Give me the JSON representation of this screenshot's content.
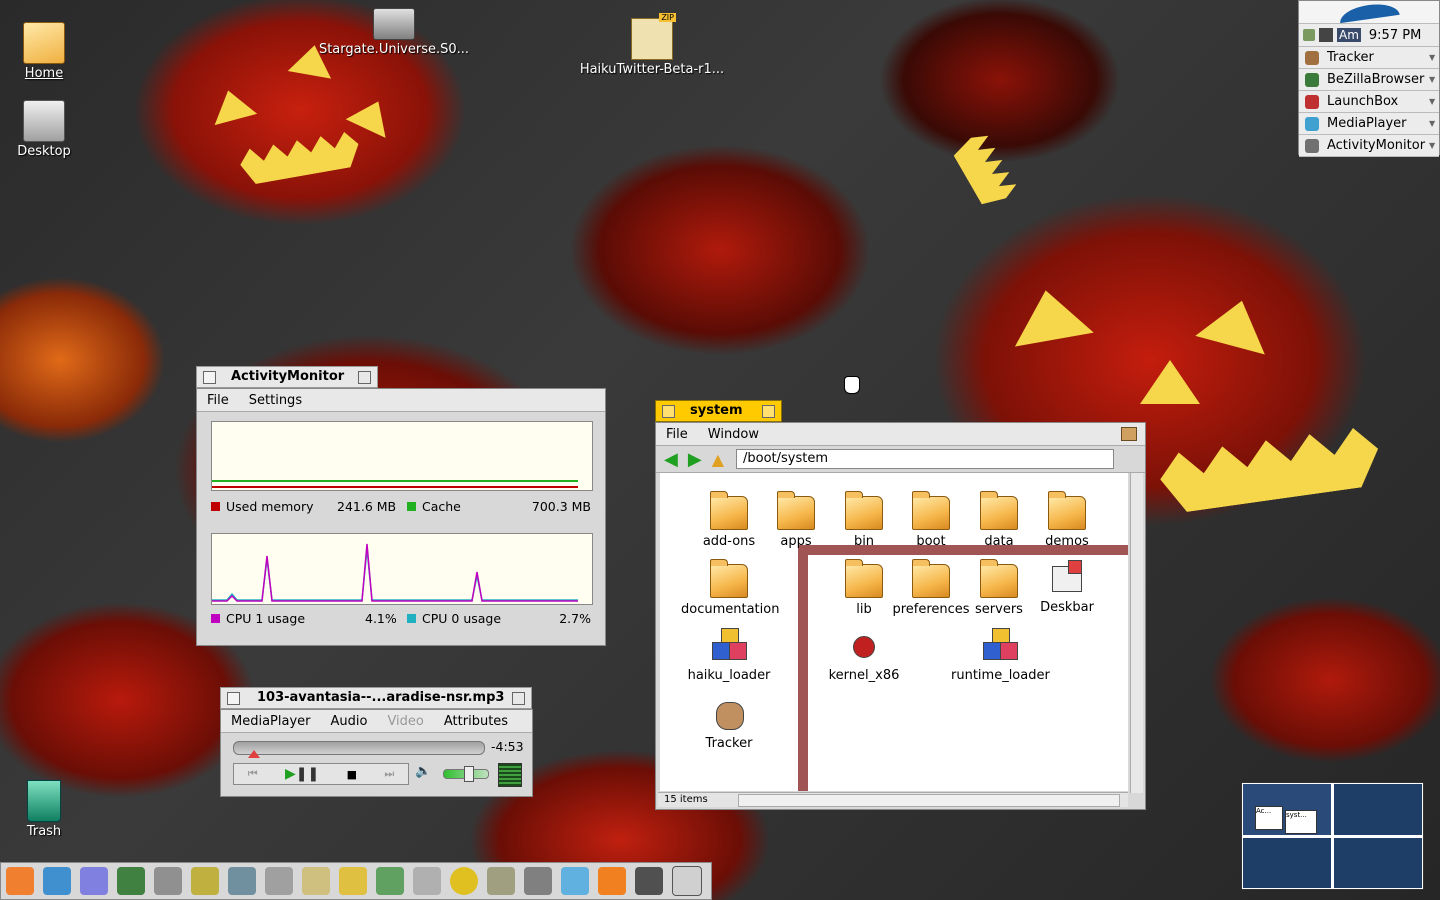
{
  "desktop": {
    "icons": [
      {
        "label": "Home"
      },
      {
        "label": "Desktop"
      },
      {
        "label": "Stargate.Universe.S0..."
      },
      {
        "label": "HaikuTwitter-Beta-r1..."
      },
      {
        "label": "Trash"
      }
    ],
    "zip_badge": "ZIP"
  },
  "deskbar": {
    "tray_label": "Am",
    "clock": "9:57 PM",
    "items": [
      {
        "label": "Tracker",
        "icon": "tracker-icon",
        "color": "#a07040"
      },
      {
        "label": "BeZillaBrowser",
        "icon": "globe-icon",
        "color": "#3a7a3a"
      },
      {
        "label": "LaunchBox",
        "icon": "rocket-icon",
        "color": "#c03030"
      },
      {
        "label": "MediaPlayer",
        "icon": "media-player-icon",
        "color": "#40a0d0"
      },
      {
        "label": "ActivityMonitor",
        "icon": "activity-monitor-icon",
        "color": "#707070"
      }
    ]
  },
  "activity_monitor": {
    "title": "ActivityMonitor",
    "menu": [
      "File",
      "Settings"
    ],
    "memory_legend": [
      {
        "label": "Used memory",
        "value": "241.6 MB",
        "color": "#c00000"
      },
      {
        "label": "Cache",
        "value": "700.3 MB",
        "color": "#20b020"
      }
    ],
    "cpu_legend": [
      {
        "label": "CPU 1 usage",
        "value": "4.1%",
        "color": "#c000c0"
      },
      {
        "label": "CPU 0 usage",
        "value": "2.7%",
        "color": "#20b0c0"
      }
    ]
  },
  "media_player": {
    "title": "103-avantasia--...aradise-nsr.mp3",
    "menu": [
      "MediaPlayer",
      "Audio",
      "Video",
      "Attributes"
    ],
    "time_remaining": "-4:53",
    "progress": 0.08,
    "volume": 0.55
  },
  "tracker": {
    "title": "system",
    "menu": [
      "File",
      "Window"
    ],
    "path": "/boot/system",
    "status": "15 items",
    "items": [
      {
        "label": "add-ons",
        "kind": "folder"
      },
      {
        "label": "apps",
        "kind": "folder"
      },
      {
        "label": "bin",
        "kind": "folder"
      },
      {
        "label": "boot",
        "kind": "folder"
      },
      {
        "label": "data",
        "kind": "folder"
      },
      {
        "label": "demos",
        "kind": "folder"
      },
      {
        "label": "documentation",
        "kind": "folder"
      },
      {
        "label": "lib",
        "kind": "folder"
      },
      {
        "label": "preferences",
        "kind": "folder"
      },
      {
        "label": "servers",
        "kind": "folder"
      },
      {
        "label": "Deskbar",
        "kind": "app"
      },
      {
        "label": "haiku_loader",
        "kind": "package"
      },
      {
        "label": "kernel_x86",
        "kind": "kernel"
      },
      {
        "label": "runtime_loader",
        "kind": "package"
      },
      {
        "label": "Tracker",
        "kind": "tracker"
      }
    ]
  },
  "workspaces": {
    "mini_labels": [
      "Ac...",
      "syst..."
    ]
  },
  "launchbar": {
    "icons": [
      "haiku-icon",
      "bird-icon",
      "gift-icon",
      "tree-icon",
      "printer-icon",
      "ruler-icon",
      "computer-icon",
      "drive-icon",
      "magnifier-icon",
      "pencil-icon",
      "brush-icon",
      "camera-icon",
      "clock-icon",
      "tools-icon",
      "car-icon",
      "jar-icon",
      "cone-icon",
      "disk-icon",
      "terminal-icon"
    ]
  }
}
